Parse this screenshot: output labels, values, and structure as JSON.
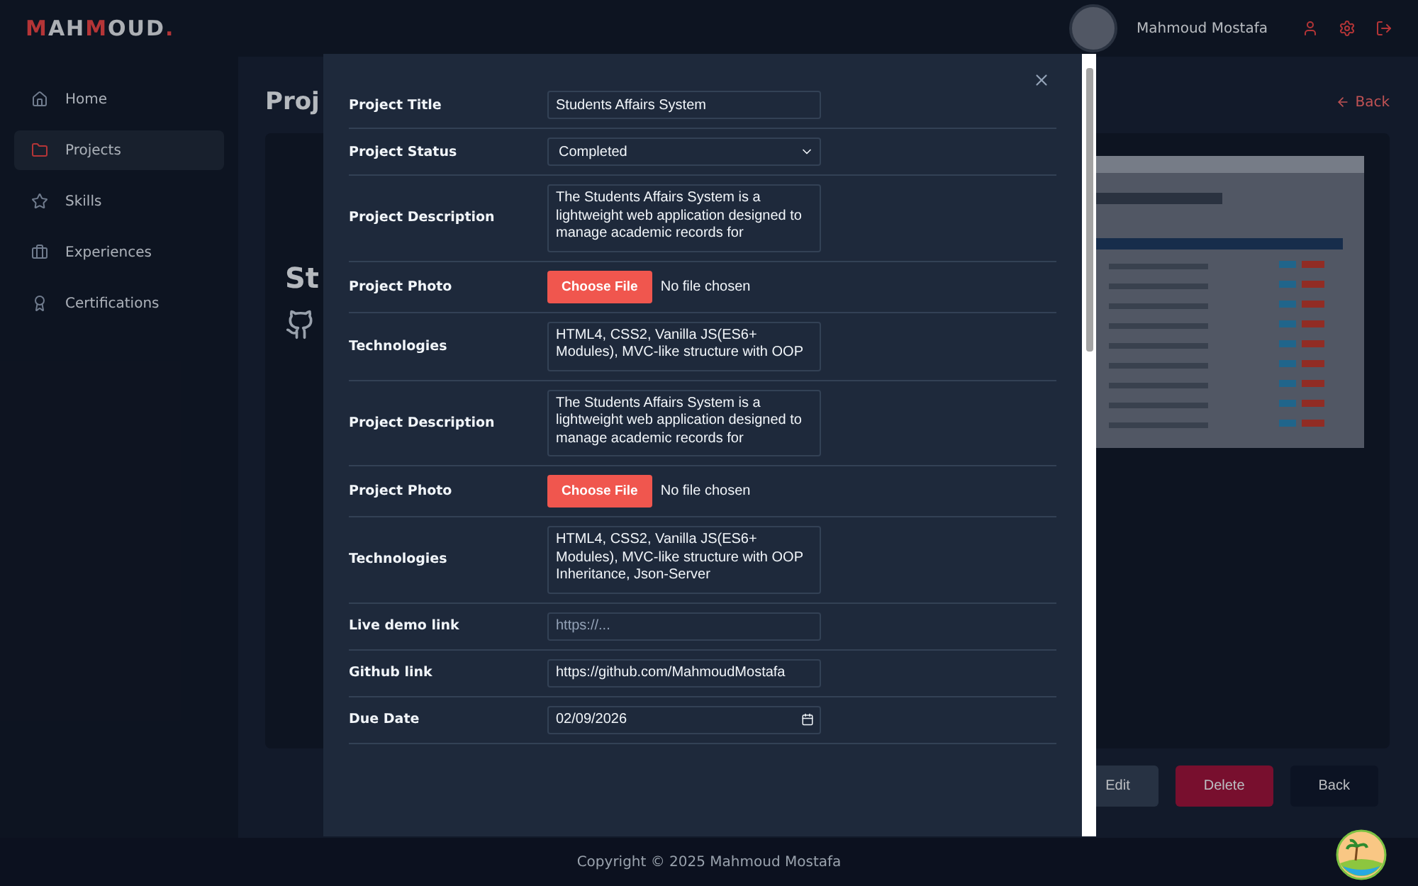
{
  "header": {
    "logo": [
      {
        "text": "M",
        "accent": true
      },
      {
        "text": "AH",
        "accent": false
      },
      {
        "text": "M",
        "accent": true
      },
      {
        "text": "OUD",
        "accent": false
      },
      {
        "text": ".",
        "accent": true
      }
    ],
    "user_name": "Mahmoud Mostafa"
  },
  "sidebar": {
    "items": [
      {
        "label": "Home",
        "selected": false
      },
      {
        "label": "Projects",
        "selected": true
      },
      {
        "label": "Skills",
        "selected": false
      },
      {
        "label": "Experiences",
        "selected": false
      },
      {
        "label": "Certifications",
        "selected": false
      }
    ]
  },
  "main": {
    "title": "Proj",
    "back_link": "Back",
    "card_heading": "St"
  },
  "actions": [
    {
      "label": "Edit",
      "kind": "edit"
    },
    {
      "label": "Delete",
      "kind": "delete"
    },
    {
      "label": "Back",
      "kind": "back"
    }
  ],
  "footer": "Copyright © 2025 Mahmoud Mostafa",
  "modal": {
    "fields": [
      {
        "label": "Project Title",
        "kind": "text",
        "value": "Students Affairs System"
      },
      {
        "label": "Project Status",
        "kind": "select",
        "value": "Completed"
      },
      {
        "label": "Project Description",
        "kind": "textarea",
        "value": "The Students Affairs System is a lightweight web application designed to manage academic records for"
      },
      {
        "label": "Project Photo",
        "kind": "file",
        "button": "Choose File",
        "status": "No file chosen"
      },
      {
        "label": "Technologies",
        "kind": "textarea",
        "value": "HTML4, CSS2, Vanilla JS(ES6+ Modules), MVC-like structure with OOP"
      },
      {
        "label": "Project Description",
        "kind": "textarea",
        "value": "The Students Affairs System is a lightweight web application designed to manage academic records for"
      },
      {
        "label": "Project Photo",
        "kind": "file",
        "button": "Choose File",
        "status": "No file chosen"
      },
      {
        "label": "Technologies",
        "kind": "textarea",
        "value": "HTML4, CSS2, Vanilla JS(ES6+ Modules), MVC-like structure with OOP Inheritance, Json-Server"
      },
      {
        "label": "Live demo link",
        "kind": "text",
        "placeholder": "https://..."
      },
      {
        "label": "Github link",
        "kind": "text",
        "value": "https://github.com/MahmoudMostafa"
      },
      {
        "label": "Due Date",
        "kind": "date",
        "value": "02/09/2026"
      }
    ]
  }
}
